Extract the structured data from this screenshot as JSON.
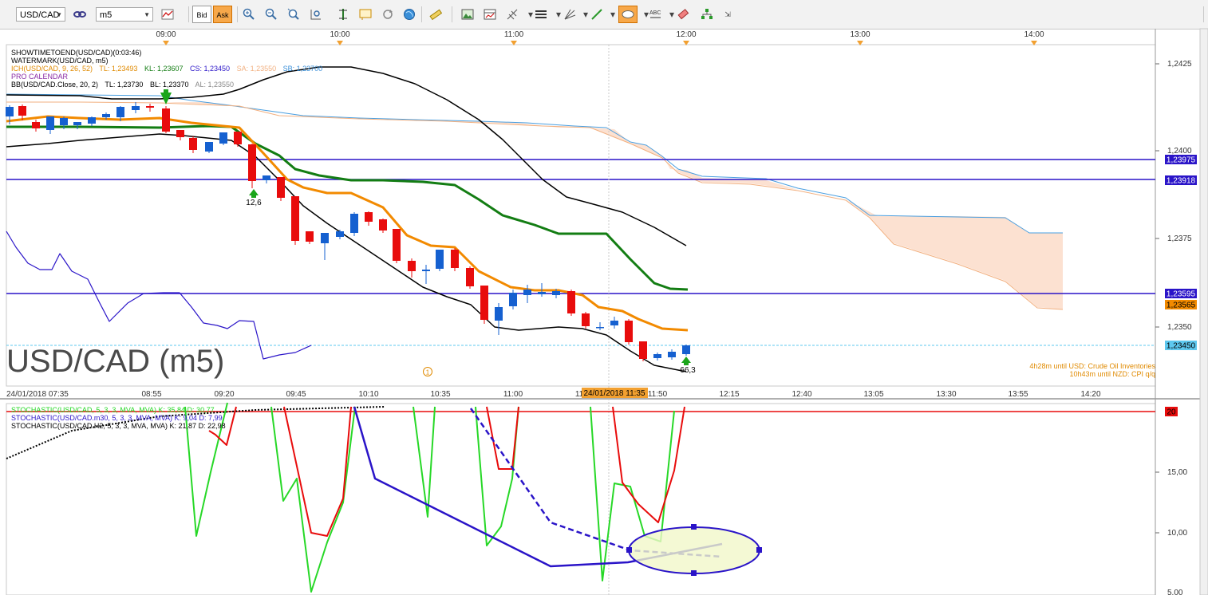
{
  "toolbar": {
    "symbol": "USD/CAD",
    "timeframe": "m5",
    "bid_label": "Bid",
    "ask_label": "Ask"
  },
  "chart": {
    "watermark": "USD/CAD (m5)",
    "time_labels_top": [
      "09:00",
      "10:00",
      "11:00",
      "12:00",
      "13:00",
      "14:00"
    ],
    "time_labels_bottom": [
      "24/01/2018 07:35",
      "08:55",
      "09:20",
      "09:45",
      "10:10",
      "10:35",
      "11:00",
      "11:25",
      "11:50",
      "12:15",
      "12:40",
      "13:05",
      "13:30",
      "13:55",
      "14:20"
    ],
    "crosshair_time": "24/01/2018 11:35",
    "price_ticks": [
      "1,2425",
      "1,2400",
      "1,2375",
      "1,2350"
    ],
    "price_tags": [
      {
        "text": "1,23975",
        "bg": "#2a14c8",
        "fg": "#ffffff"
      },
      {
        "text": "1,23918",
        "bg": "#2a14c8",
        "fg": "#ffffff"
      },
      {
        "text": "1,23595",
        "bg": "#2a14c8",
        "fg": "#ffffff"
      },
      {
        "text": "1,23565",
        "bg": "#f28a00",
        "fg": "#000000"
      },
      {
        "text": "1,23450",
        "bg": "#5ec8ef",
        "fg": "#000000"
      }
    ],
    "legend": {
      "line1": "SHOWTIMETOEND(USD/CAD)(0:03:46)",
      "line2": "WATERMARK(USD/CAD, m5)",
      "line3_prefix": "ICH(USD/CAD, 9, 26, 52)",
      "line3_tl": "TL: 1,23493",
      "line3_kl": "KL: 1,23607",
      "line3_cs": "CS: 1,23450",
      "line3_sa": "SA: 1,23550",
      "line3_sb": "SB: 1,23700",
      "line4": "PRO CALENDAR",
      "line5_prefix": "BB(USD/CAD.Close, 20, 2)",
      "line5_tl": "TL: 1,23730",
      "line5_bl": "BL: 1,23370",
      "line5_al": "AL: 1,23550"
    },
    "marker_12_6": "12,6",
    "marker_66_3": "66,3",
    "event_badge": "1",
    "news_line1": "4h28m until USD: Crude Oil Inventories",
    "news_line2": "10h43m until NZD: CPI q/q",
    "colors": {
      "bull": "#1560d0",
      "bear": "#e80c0c",
      "tenkan": "#f28a00",
      "kijun": "#137d13",
      "cloud": "#fbd4bd",
      "bollinger": "#000000",
      "hline": "#2a14c8",
      "chikou": "#2a14c8"
    }
  },
  "lower_pane": {
    "legend1": "STOCHASTIC(USD/CAD, 5, 3, 3, MVA, MVA)  K: 35,84  D: 30,77",
    "legend2": "STOCHASTIC(USD/CAD.m30, 5, 3, 3, MVA, MVA)  K: 9,04  D: 7,99",
    "legend3": "STOCHASTIC(USD/CAD.H2, 5, 3, 3, MVA, MVA)  K: 21,87  D: 22,98",
    "ticks": [
      "15,00",
      "10,00",
      "5,00"
    ],
    "level_tag": "20",
    "level_color": "#e80c0c"
  }
}
